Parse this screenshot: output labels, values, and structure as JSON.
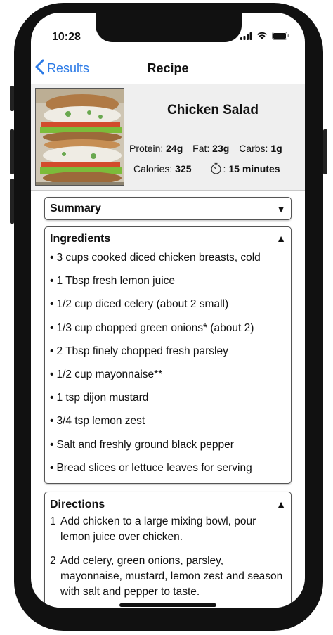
{
  "status": {
    "time": "10:28"
  },
  "nav": {
    "back_label": "Results",
    "title": "Recipe"
  },
  "recipe": {
    "name": "Chicken Salad",
    "protein_label": "Protein:",
    "protein": "24g",
    "fat_label": "Fat:",
    "fat": "23g",
    "carbs_label": "Carbs:",
    "carbs": "1g",
    "calories_label": "Calories:",
    "calories": "325",
    "time_sep": ":",
    "time": "15 minutes"
  },
  "summary": {
    "title": "Summary",
    "arrow": "▼"
  },
  "ingredients": {
    "title": "Ingredients",
    "arrow": "▲",
    "items": [
      "3 cups cooked diced chicken breasts, cold",
      "1 Tbsp fresh lemon juice",
      "1/2 cup diced celery (about 2 small)",
      "1/3 cup chopped green onions* (about 2)",
      "2 Tbsp finely chopped fresh parsley",
      "1/2 cup mayonnaise**",
      "1 tsp dijon mustard",
      "3/4 tsp lemon zest",
      "Salt and freshly ground black pepper",
      "Bread slices or lettuce leaves for serving"
    ]
  },
  "directions": {
    "title": "Directions",
    "arrow": "▲",
    "steps": [
      {
        "num": "1",
        "text": "Add chicken to a large mixing bowl, pour lemon juice over chicken."
      },
      {
        "num": "2",
        "text": "Add celery, green onions, parsley, mayonnaise, mustard, lemon zest and season with salt and pepper to taste."
      }
    ]
  },
  "colors": {
    "accent": "#2b7ae6",
    "header_bg": "#efefef"
  },
  "icons": [
    "chevron-left-icon",
    "wifi-icon",
    "battery-icon",
    "signal-icon",
    "timer-icon",
    "triangle-down-icon",
    "triangle-up-icon"
  ]
}
